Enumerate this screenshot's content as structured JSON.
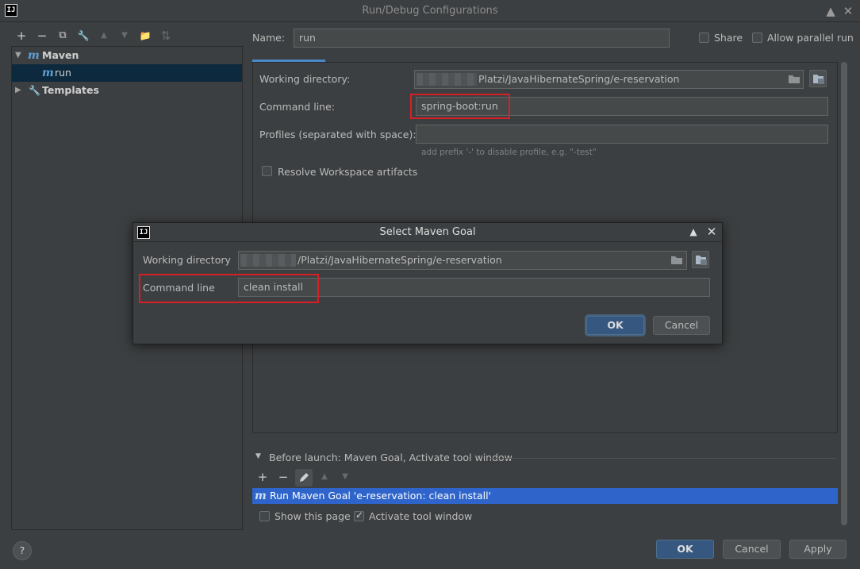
{
  "window": {
    "title": "Run/Debug Configurations",
    "app_icon": "IJ"
  },
  "toolbar": {
    "add": "+",
    "remove": "−",
    "copy": "⧉",
    "wrench": "🔧",
    "up": "▲",
    "down": "▼",
    "folder": "📁",
    "sort": "⇅"
  },
  "tree": {
    "maven_label": "Maven",
    "run_label": "run",
    "templates_label": "Templates",
    "m_glyph": "m"
  },
  "config": {
    "name_label": "Name:",
    "name_value": "run",
    "share_label": "Share",
    "allow_parallel_label": "Allow parallel run",
    "working_dir_label": "Working directory:",
    "working_dir_value": "Platzi/JavaHibernateSpring/e-reservation",
    "command_line_label": "Command line:",
    "command_line_value": "spring-boot:run",
    "profiles_label": "Profiles (separated with space):",
    "profiles_value": "",
    "profiles_hint": "add prefix '-' to disable profile, e.g. \"-test\"",
    "resolve_label": "Resolve Workspace artifacts"
  },
  "before_launch": {
    "header": "Before launch: Maven Goal, Activate tool window",
    "task": "Run Maven Goal 'e-reservation: clean install'",
    "show_page_label": "Show this page",
    "activate_label": "Activate tool window"
  },
  "buttons": {
    "ok": "OK",
    "cancel": "Cancel",
    "apply": "Apply",
    "help": "?"
  },
  "dialog": {
    "title": "Select Maven Goal",
    "working_dir_label": "Working directory",
    "working_dir_value": "/Platzi/JavaHibernateSpring/e-reservation",
    "command_line_label": "Command line",
    "command_line_value": "clean install",
    "ok": "OK",
    "cancel": "Cancel"
  },
  "colors": {
    "accent": "#2f65ca",
    "highlight_box": "#d81f26",
    "tree_selected": "#0d293e"
  }
}
